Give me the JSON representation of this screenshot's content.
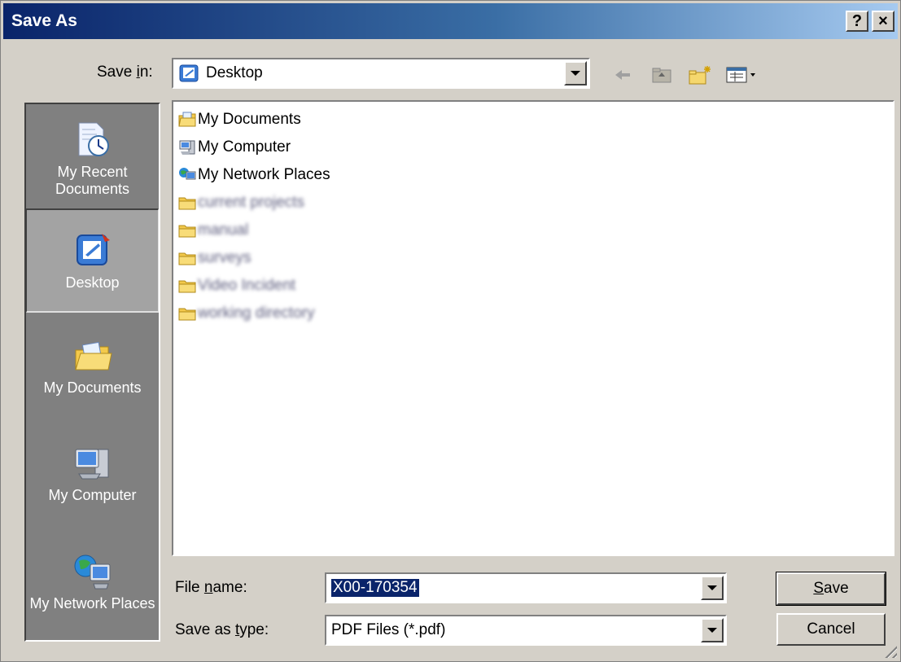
{
  "window": {
    "title": "Save As",
    "help_button": "?",
    "close_button": "×"
  },
  "save_in": {
    "label_pre": "Save ",
    "label_key": "i",
    "label_post": "n:",
    "value": "Desktop",
    "icon": "desktop-icon"
  },
  "toolbar": {
    "back": "back-arrow-icon",
    "up": "up-folder-icon",
    "new_folder": "new-folder-icon",
    "views": "views-menu-icon"
  },
  "places": [
    {
      "label": "My Recent Documents",
      "icon": "recent-documents-icon"
    },
    {
      "label": "Desktop",
      "icon": "desktop-icon",
      "selected": true
    },
    {
      "label": "My Documents",
      "icon": "my-documents-icon"
    },
    {
      "label": "My Computer",
      "icon": "my-computer-icon"
    },
    {
      "label": "My Network Places",
      "icon": "network-places-icon"
    }
  ],
  "files": [
    {
      "label": "My Documents",
      "icon": "my-documents-icon"
    },
    {
      "label": "My Computer",
      "icon": "my-computer-icon"
    },
    {
      "label": "My Network Places",
      "icon": "network-places-icon"
    },
    {
      "label": "current projects",
      "icon": "folder-icon",
      "blurred": true
    },
    {
      "label": "manual",
      "icon": "folder-icon",
      "blurred": true
    },
    {
      "label": "surveys",
      "icon": "folder-icon",
      "blurred": true
    },
    {
      "label": "Video Incident",
      "icon": "folder-icon",
      "blurred": true
    },
    {
      "label": "working directory",
      "icon": "folder-icon",
      "blurred": true
    }
  ],
  "file_name": {
    "label_pre": "File ",
    "label_key": "n",
    "label_post": "ame:",
    "value": "X00-170354"
  },
  "save_as_type": {
    "label_pre": "Save as ",
    "label_key": "t",
    "label_post": "ype:",
    "value": "PDF Files (*.pdf)"
  },
  "buttons": {
    "save_key": "S",
    "save_rest": "ave",
    "cancel": "Cancel"
  },
  "colors": {
    "title_start": "#0a246a",
    "title_end": "#a6caf0",
    "places_bg": "#808080",
    "selection": "#0a246a"
  }
}
